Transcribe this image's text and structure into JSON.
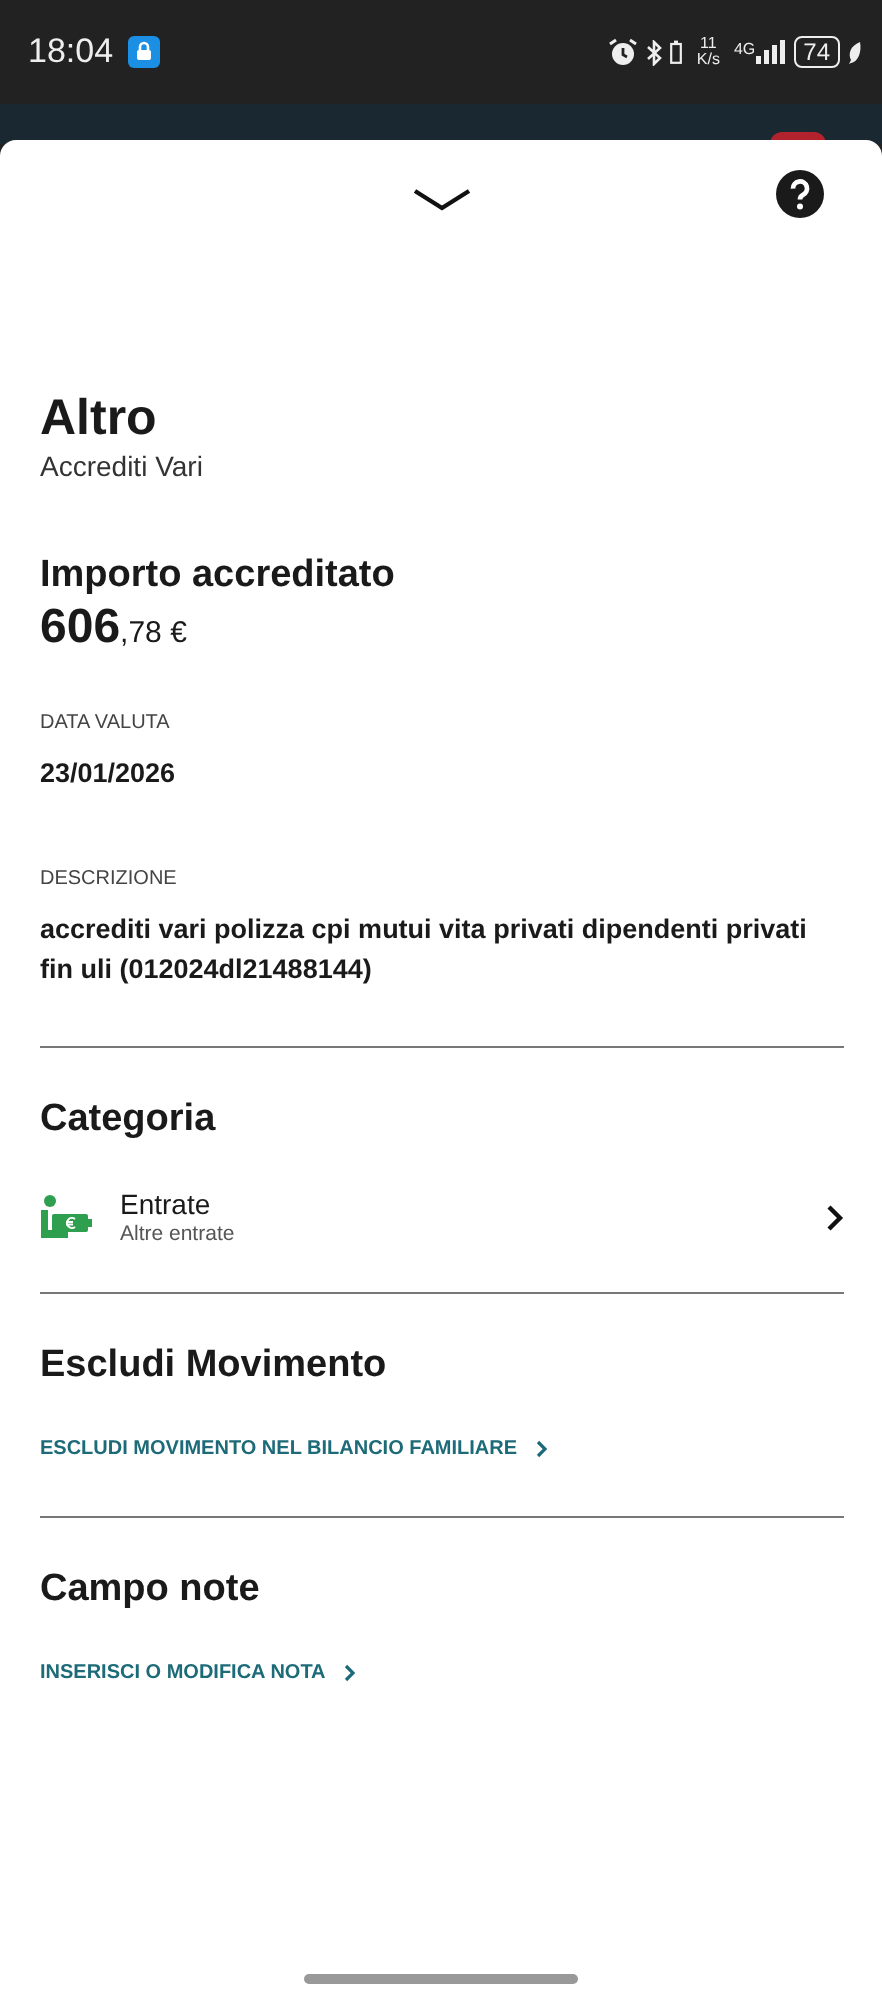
{
  "status_bar": {
    "time": "18:04",
    "speed_value": "11",
    "speed_unit": "K/s",
    "network": "4G",
    "battery": "74"
  },
  "header": {
    "title": "Altro",
    "subtitle": "Accrediti Vari"
  },
  "amount": {
    "label": "Importo accreditato",
    "integer": "606",
    "decimal": ",78 €"
  },
  "fields": [
    {
      "label": "DATA VALUTA",
      "value": "23/01/2026"
    },
    {
      "label": "DESCRIZIONE",
      "value": "accrediti vari polizza cpi mutui vita privati dipendenti privati fin uli (012024dl21488144)"
    }
  ],
  "category": {
    "heading": "Categoria",
    "name": "Entrate",
    "subcategory": "Altre entrate"
  },
  "exclude": {
    "heading": "Escludi Movimento",
    "link": "ESCLUDI MOVIMENTO NEL BILANCIO FAMILIARE"
  },
  "notes": {
    "heading": "Campo note",
    "link": "INSERISCI O MODIFICA NOTA"
  }
}
